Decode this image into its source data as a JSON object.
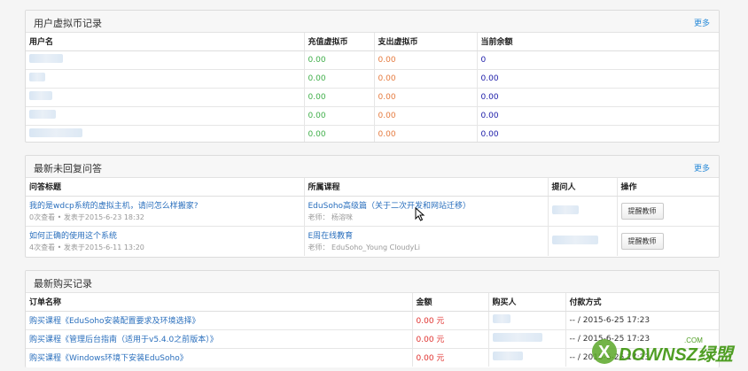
{
  "coin_panel": {
    "title": "用户虚拟币记录",
    "more": "更多",
    "headers": [
      "用户名",
      "充值虚拟币",
      "支出虚拟币",
      "当前余额"
    ],
    "rows": [
      {
        "recharge": "0.00",
        "spend": "0.00",
        "balance": "0"
      },
      {
        "recharge": "0.00",
        "spend": "0.00",
        "balance": "0.00"
      },
      {
        "recharge": "0.00",
        "spend": "0.00",
        "balance": "0.00"
      },
      {
        "recharge": "0.00",
        "spend": "0.00",
        "balance": "0.00"
      },
      {
        "recharge": "0.00",
        "spend": "0.00",
        "balance": "0.00"
      }
    ]
  },
  "qa_panel": {
    "title": "最新未回复问答",
    "more": "更多",
    "headers": [
      "问答标题",
      "所属课程",
      "提问人",
      "操作"
    ],
    "rows": [
      {
        "title": "我的是wdcp系统的虚拟主机，请问怎么样搬家?",
        "meta": "0次查看 • 发表于2015-6-23 18:32",
        "course": "EduSoho高级篇（关于二次开发和网站迁移）",
        "teacher": "老师：  杨溶咪",
        "action": "提醒教师"
      },
      {
        "title": "如何正确的使用这个系统",
        "meta": "4次查看 • 发表于2015-6-11 13:20",
        "course": "E周在线教育",
        "teacher": "老师：  EduSoho_Young CloudyLi",
        "action": "提醒教师"
      }
    ]
  },
  "order_panel": {
    "title": "最新购买记录",
    "headers": [
      "订单名称",
      "金额",
      "购买人",
      "付款方式"
    ],
    "rows": [
      {
        "name": "购买课程《EduSoho安装配置要求及环境选择》",
        "amount": "0.00 元",
        "pay": "-- / 2015-6-25 17:23"
      },
      {
        "name": "购买课程《管理后台指南（适用于v5.4.0之前版本）》",
        "amount": "0.00 元",
        "pay": "-- / 2015-6-25 17:23"
      },
      {
        "name": "购买课程《Windows环境下安装EduSoho》",
        "amount": "0.00 元",
        "pay": "-- / 2015-6-25 17:23"
      }
    ]
  },
  "watermark": {
    "text": "DOWNSZ绿盟",
    "sub": ".COM"
  },
  "colors": {
    "green": "#3fae49",
    "orange": "#e57a3e",
    "blue": "#1a1aa8",
    "red": "#e0322f",
    "link": "#2a6fbd"
  }
}
